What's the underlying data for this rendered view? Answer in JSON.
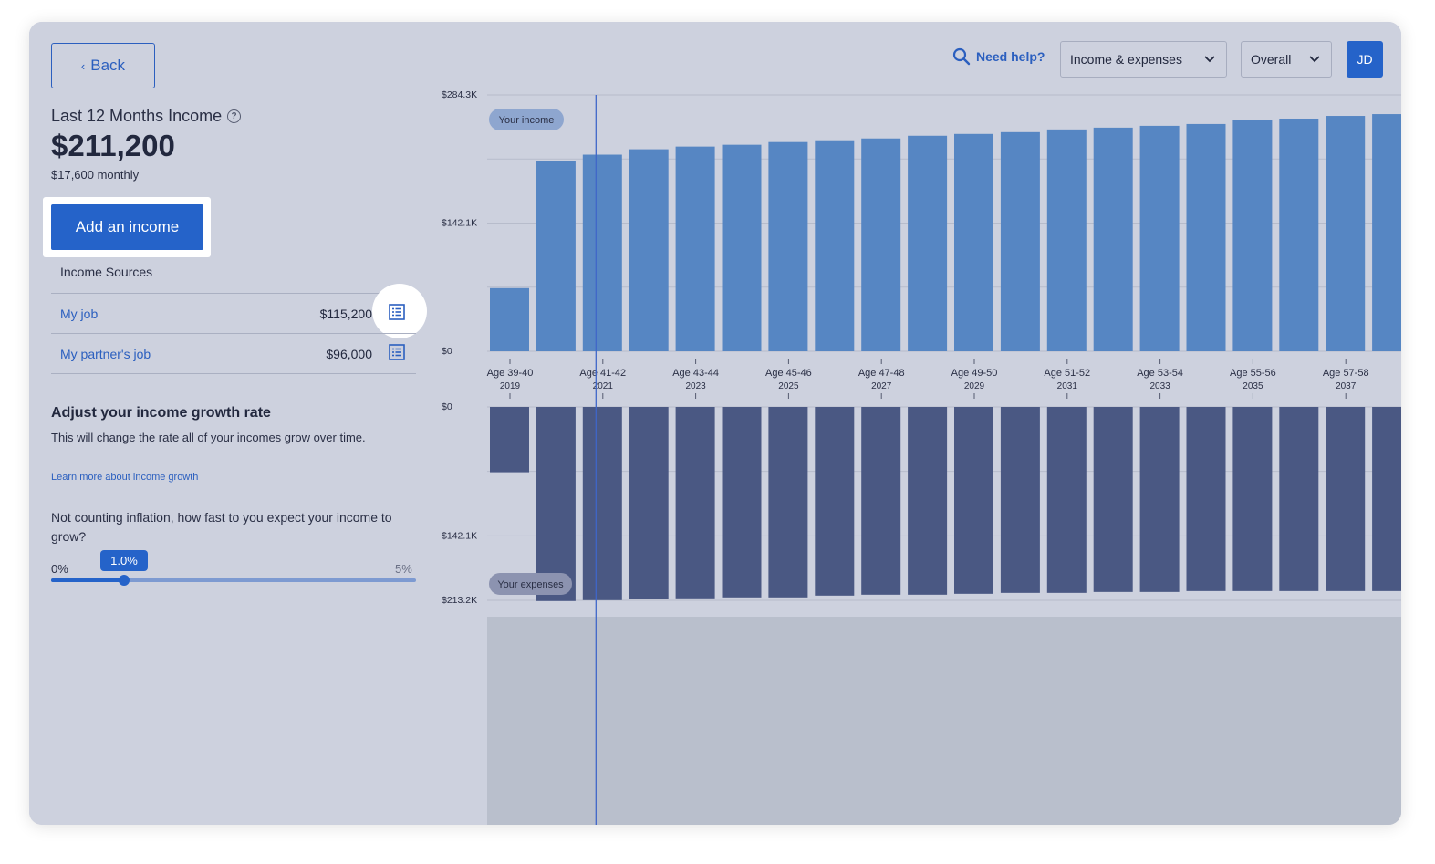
{
  "left_panel": {
    "back_label": "Back",
    "income_title": "Last 12 Months Income",
    "income_total": "$211,200",
    "income_monthly": "$17,600 monthly",
    "add_income_label": "Add an income",
    "sources_label": "Income Sources",
    "sources": [
      {
        "name": "My job",
        "value": "$115,200"
      },
      {
        "name": "My partner's job",
        "value": "$96,000"
      }
    ],
    "growth": {
      "title": "Adjust your income growth rate",
      "description": "This will change the rate all of your incomes grow over time.",
      "link": "Learn more about income growth",
      "question": "Not counting inflation, how fast to you expect your income to grow?",
      "slider_min": "0%",
      "slider_max": "5%",
      "slider_value_label": "1.0%",
      "slider_value": 1.0,
      "slider_max_value": 5.0
    }
  },
  "header": {
    "help_label": "Need help?",
    "view_select": "Income & expenses",
    "scope_select": "Overall",
    "avatar_initials": "JD"
  },
  "colors": {
    "accent": "#2563c9",
    "income_bar": "#5686c3",
    "expense_bar": "#4a5883",
    "marker_line": "#3f66c9"
  },
  "chart_data": {
    "type": "bar",
    "income_series_label": "Your income",
    "expense_series_label": "Your expenses",
    "income_ticks": [
      "$284.3K",
      "$142.1K",
      "$0"
    ],
    "income_ylim": [
      0,
      284300
    ],
    "expense_ticks": [
      "$0",
      "$142.1K",
      "$213.2K"
    ],
    "expense_ylim": [
      0,
      213200
    ],
    "x_labels": [
      {
        "age": "Age 39-40",
        "year": "2019"
      },
      {
        "age": "Age 41-42",
        "year": "2021"
      },
      {
        "age": "Age 43-44",
        "year": "2023"
      },
      {
        "age": "Age 45-46",
        "year": "2025"
      },
      {
        "age": "Age 47-48",
        "year": "2027"
      },
      {
        "age": "Age 49-50",
        "year": "2029"
      },
      {
        "age": "Age 51-52",
        "year": "2031"
      },
      {
        "age": "Age 53-54",
        "year": "2033"
      },
      {
        "age": "Age 55-56",
        "year": "2035"
      },
      {
        "age": "Age 57-58",
        "year": "2037"
      }
    ],
    "income": [
      70000,
      211000,
      218000,
      224000,
      227000,
      229000,
      232000,
      234000,
      236000,
      239000,
      241000,
      243000,
      246000,
      248000,
      250000,
      252000,
      256000,
      258000,
      261000,
      263000
    ],
    "expenses": [
      72000,
      214000,
      213000,
      212000,
      211000,
      210000,
      210000,
      208000,
      207000,
      207000,
      206000,
      205000,
      205000,
      204000,
      204000,
      203000,
      203000,
      203000,
      203000,
      203000
    ],
    "marker_index": 2
  }
}
